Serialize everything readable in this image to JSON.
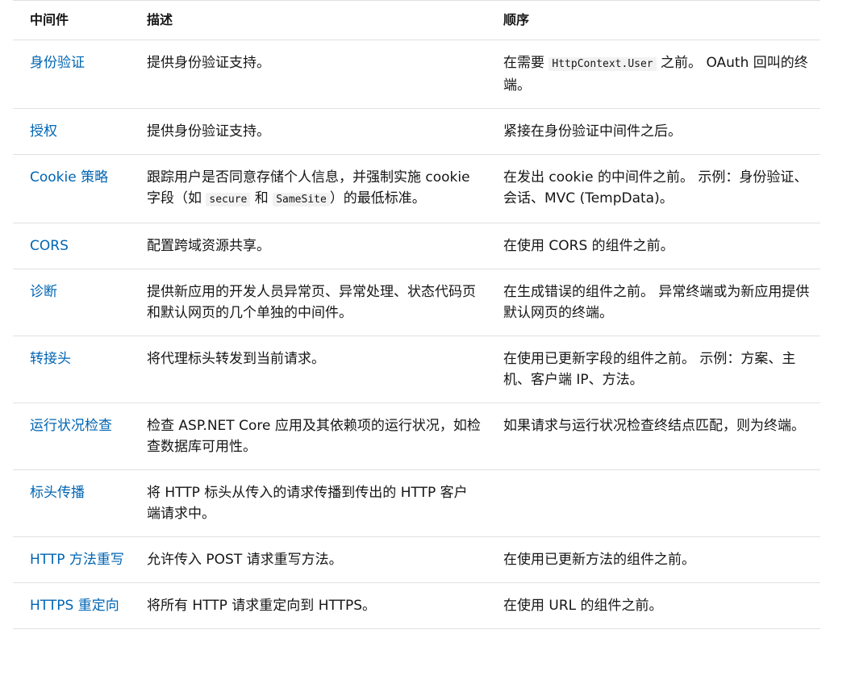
{
  "table": {
    "headers": [
      "中间件",
      "描述",
      "顺序"
    ],
    "rows": [
      {
        "name": "身份验证",
        "desc_parts": [
          "提供身份验证支持。"
        ],
        "order_parts": [
          "在需要 ",
          "HttpContext.User",
          " 之前。 OAuth 回叫的终端。"
        ]
      },
      {
        "name": "授权",
        "desc_parts": [
          "提供身份验证支持。"
        ],
        "order_parts": [
          "紧接在身份验证中间件之后。"
        ]
      },
      {
        "name": "Cookie 策略",
        "desc_parts": [
          "跟踪用户是否同意存储个人信息，并强制实施 cookie 字段（如 ",
          "secure",
          " 和 ",
          "SameSite",
          "）的最低标准。"
        ],
        "order_parts": [
          "在发出 cookie 的中间件之前。 示例：身份验证、会话、MVC (TempData)。"
        ]
      },
      {
        "name": "CORS",
        "desc_parts": [
          "配置跨域资源共享。"
        ],
        "order_parts": [
          "在使用 CORS 的组件之前。"
        ]
      },
      {
        "name": "诊断",
        "desc_parts": [
          "提供新应用的开发人员异常页、异常处理、状态代码页和默认网页的几个单独的中间件。"
        ],
        "order_parts": [
          "在生成错误的组件之前。 异常终端或为新应用提供默认网页的终端。"
        ]
      },
      {
        "name": "转接头",
        "desc_parts": [
          "将代理标头转发到当前请求。"
        ],
        "order_parts": [
          "在使用已更新字段的组件之前。 示例：方案、主机、客户端 IP、方法。"
        ]
      },
      {
        "name": "运行状况检查",
        "desc_parts": [
          "检查 ASP.NET Core 应用及其依赖项的运行状况，如检查数据库可用性。"
        ],
        "order_parts": [
          "如果请求与运行状况检查终结点匹配，则为终端。"
        ]
      },
      {
        "name": "标头传播",
        "desc_parts": [
          "将 HTTP 标头从传入的请求传播到传出的 HTTP 客户端请求中。"
        ],
        "order_parts": [
          ""
        ]
      },
      {
        "name": "HTTP 方法重写",
        "desc_parts": [
          "允许传入 POST 请求重写方法。"
        ],
        "order_parts": [
          "在使用已更新方法的组件之前。"
        ]
      },
      {
        "name": "HTTPS 重定向",
        "desc_parts": [
          "将所有 HTTP 请求重定向到 HTTPS。"
        ],
        "order_parts": [
          "在使用 URL 的组件之前。"
        ]
      }
    ]
  }
}
